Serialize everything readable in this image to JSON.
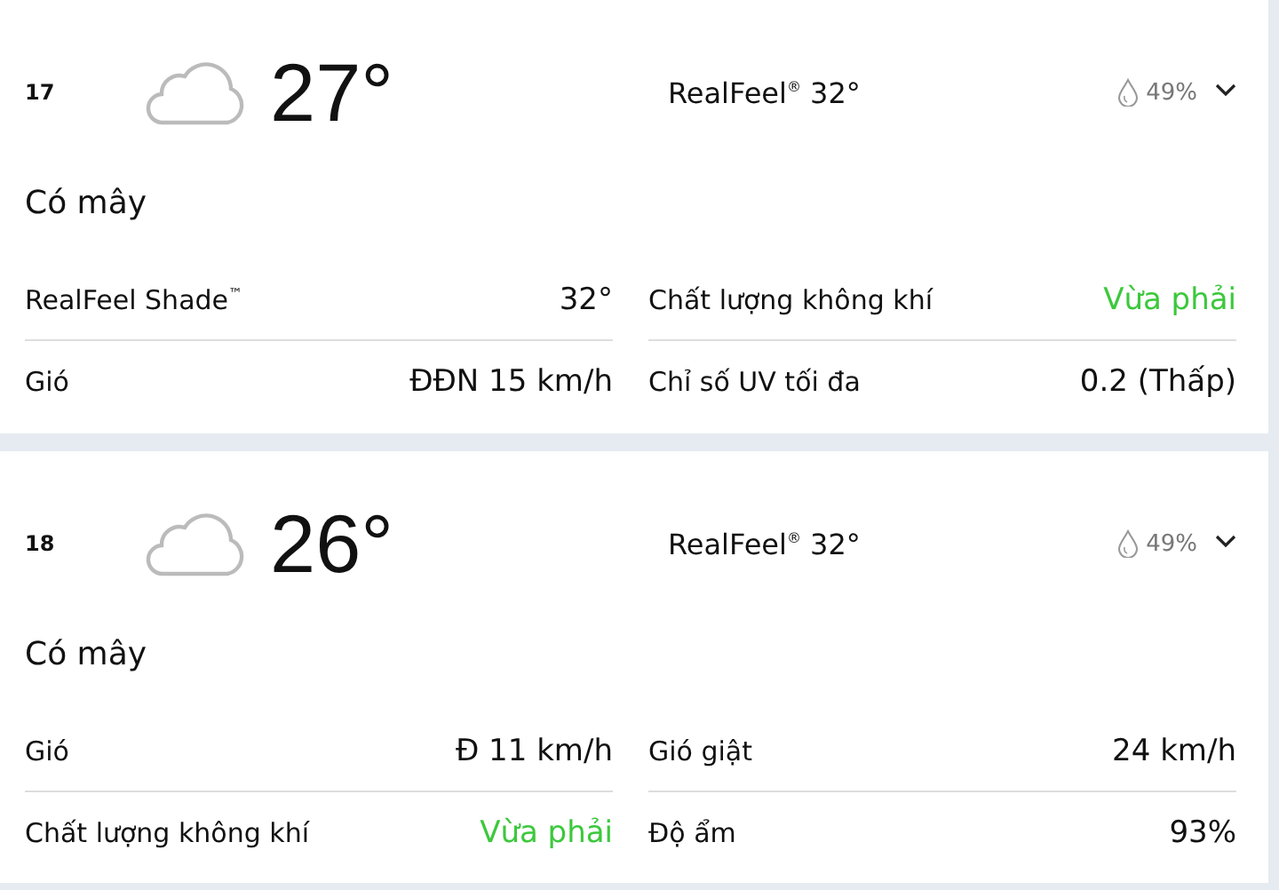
{
  "hours": [
    {
      "hour": "17",
      "temperature": "27°",
      "realfeel": "RealFeel$^{®}$ 32°",
      "precipitation": "49%",
      "condition": "Có mây",
      "details": [
        {
          "label": "RealFeel Shade$^{™}$",
          "value": "32°"
        },
        {
          "label": "Chất lượng không khí",
          "value": "Vừa phải",
          "color": "#3cc83c"
        },
        {
          "label": "Gió",
          "value": "ĐĐN 15 km/h"
        },
        {
          "label": "Chỉ số UV tối đa",
          "value": "0.2 (Thấp)"
        }
      ]
    },
    {
      "hour": "18",
      "temperature": "26°",
      "realfeel": "RealFeel$^{®}$ 32°",
      "precipitation": "49%",
      "condition": "Có mây",
      "details": [
        {
          "label": "Gió",
          "value": "Đ 11 km/h"
        },
        {
          "label": "Gió giật",
          "value": "24 km/h"
        },
        {
          "label": "Chất lượng không khí",
          "value": "Vừa phải",
          "color": "#3cc83c"
        },
        {
          "label": "Độ ẩm",
          "value": "93%"
        }
      ]
    }
  ]
}
